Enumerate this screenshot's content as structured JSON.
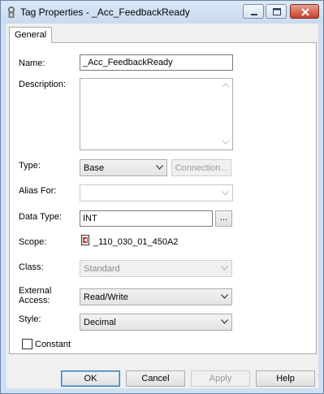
{
  "window": {
    "title": "Tag Properties - _Acc_FeedbackReady"
  },
  "tabs": [
    {
      "label": "General"
    }
  ],
  "form": {
    "name": {
      "label": "Name:",
      "value": "_Acc_FeedbackReady"
    },
    "description": {
      "label": "Description:",
      "value": ""
    },
    "type": {
      "label": "Type:",
      "value": "Base",
      "connection_button": "Connection..."
    },
    "alias_for": {
      "label": "Alias For:",
      "value": ""
    },
    "data_type": {
      "label": "Data Type:",
      "value": "INT",
      "browse_button": "..."
    },
    "scope": {
      "label": "Scope:",
      "value": "_110_030_01_450A2"
    },
    "class": {
      "label": "Class:",
      "value": "Standard"
    },
    "external_access": {
      "label_line1": "External",
      "label_line2": "Access:",
      "value": "Read/Write"
    },
    "style": {
      "label": "Style:",
      "value": "Decimal"
    },
    "constant": {
      "label": "Constant",
      "checked": false
    }
  },
  "buttons": {
    "ok": "OK",
    "cancel": "Cancel",
    "apply": "Apply",
    "help": "Help"
  }
}
